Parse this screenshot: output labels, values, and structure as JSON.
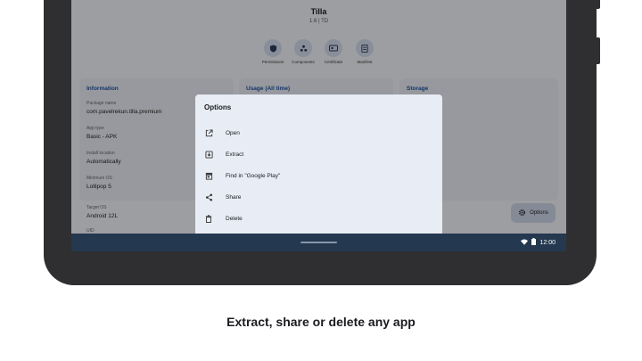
{
  "app": {
    "name": "Tilla",
    "version": "1.6 | TD"
  },
  "actions": [
    {
      "label": "Permissions",
      "icon": "shield-icon"
    },
    {
      "label": "Components",
      "icon": "components-icon"
    },
    {
      "label": "Certificate",
      "icon": "certificate-icon"
    },
    {
      "label": "Manifest",
      "icon": "manifest-icon"
    }
  ],
  "info_card": {
    "title": "Information",
    "rows": [
      {
        "label": "Package name",
        "value": "com.pavelrekun.tilla.premium"
      },
      {
        "label": "App type",
        "value": "Basic - APK"
      },
      {
        "label": "Install location",
        "value": "Automatically"
      },
      {
        "label": "Minimum OS",
        "value": "Lollipop 5"
      },
      {
        "label": "Target OS",
        "value": "Android 12L"
      },
      {
        "label": "UID",
        "value": ""
      }
    ]
  },
  "usage_card": {
    "title": "Usage (All time)"
  },
  "storage_card": {
    "title": "Storage"
  },
  "fab": {
    "label": "Options",
    "icon": "gear-icon"
  },
  "dialog": {
    "title": "Options",
    "items": [
      {
        "label": "Open",
        "icon": "open-external-icon"
      },
      {
        "label": "Extract",
        "icon": "extract-icon"
      },
      {
        "label": "Find in \"Google Play\"",
        "icon": "store-icon"
      },
      {
        "label": "Share",
        "icon": "share-icon"
      },
      {
        "label": "Delete",
        "icon": "delete-icon"
      }
    ]
  },
  "status_bar": {
    "time": "12:00"
  },
  "caption": "Extract, share or delete any app",
  "colors": {
    "accent": "#1d4f9c",
    "navbar": "#24384f",
    "frame": "#2f2f31"
  }
}
